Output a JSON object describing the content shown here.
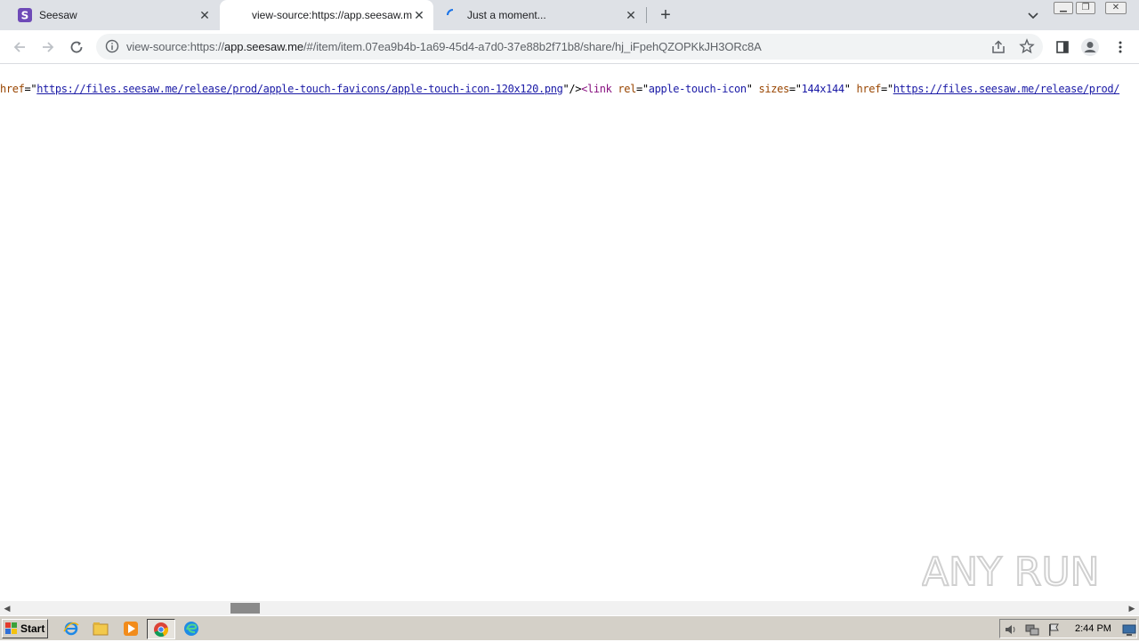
{
  "browser": {
    "tabs": [
      {
        "title": "Seesaw",
        "favicon": "seesaw-s-icon",
        "active": false
      },
      {
        "title": "view-source:https://app.seesaw.me",
        "favicon": "none",
        "active": true
      },
      {
        "title": "Just a moment...",
        "favicon": "loading-spinner-icon",
        "active": false
      }
    ],
    "new_tab_label": "+",
    "address": {
      "prefix": "view-source:https://",
      "host": "app.seesaw.me",
      "path": "/#/item/item.07ea9b4b-1a69-45d4-a7d0-37e88b2f71b8/share/hj_iFpehQZOPKkJH3ORc8A"
    },
    "icons": {
      "back": "arrow-left-icon",
      "forward": "arrow-right-icon",
      "reload": "reload-icon",
      "info": "info-icon",
      "share": "share-icon",
      "bookmark": "star-icon",
      "side_panel": "side-panel-icon",
      "profile": "profile-icon",
      "menu": "kebab-menu-icon"
    }
  },
  "source": {
    "attr1": "href",
    "eq1": "=\"",
    "url1": "https://files.seesaw.me/release/prod/apple-touch-favicons/apple-touch-icon-120x120.png",
    "close1": "\"/>",
    "tag_open": "<link",
    "attr_rel": "rel",
    "eq_rel": "=\"",
    "rel_val": "apple-touch-icon",
    "q_rel": "\"",
    "attr_sizes": "sizes",
    "eq_sizes": "=\"",
    "sizes_val": "144x144",
    "q_sizes": "\"",
    "attr2": "href",
    "eq2": "=\"",
    "url2": "https://files.seesaw.me/release/prod/"
  },
  "watermark": {
    "text": "ANY RUN"
  },
  "taskbar": {
    "start_label": "Start",
    "clock": "2:44 PM",
    "apps": [
      "internet-explorer-icon",
      "file-explorer-icon",
      "media-player-icon",
      "chrome-icon",
      "edge-icon"
    ]
  },
  "colors": {
    "tabstrip": "#dee1e6",
    "seesaw_purple": "#6e4ab7",
    "source_attr": "#994500",
    "source_value": "#1a1aa6",
    "source_tag": "#881280"
  }
}
